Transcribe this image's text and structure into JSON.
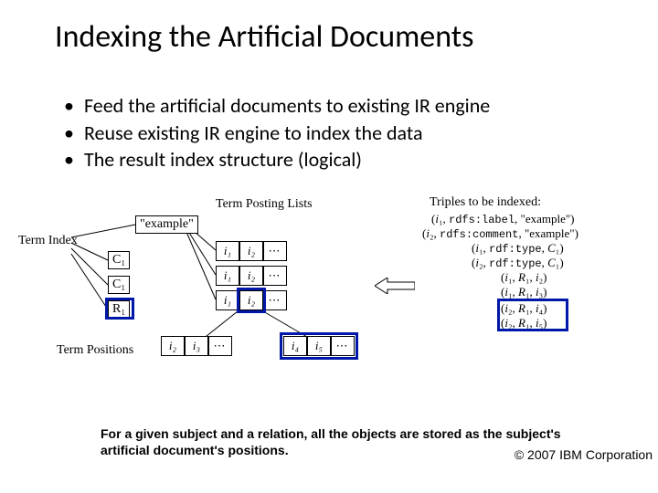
{
  "title": "Indexing the Artificial Documents",
  "bullets": [
    "Feed the artificial documents to existing IR engine",
    "Reuse existing IR engine to index the data",
    "The result index structure (logical)"
  ],
  "diagram": {
    "labels": {
      "term_posting_lists": "Term Posting Lists",
      "term_index": "Term Index",
      "term_positions": "Term Positions",
      "triples_header": "Triples to be indexed:"
    },
    "term_index_items": [
      "\"example\"",
      "C₁",
      "R₁"
    ],
    "posting_rows": [
      [
        "i₁",
        "i₂",
        "⋯"
      ],
      [
        "i₁",
        "i₂",
        "⋯"
      ],
      [
        "i₁",
        "i₂",
        "⋯"
      ]
    ],
    "position_rows": [
      [
        "i₂",
        "i₃",
        "⋯"
      ],
      [
        "i₄",
        "i₅",
        "⋯"
      ]
    ],
    "triples": [
      "(i₁, rdfs:label, \"example\")",
      "(i₂, rdfs:comment, \"example\")",
      "(i₁, rdf:type, C₁)",
      "(i₂, rdf:type, C₁)",
      "(i₁, R₁, i₂)",
      "(i₁, R₁, i₃)",
      "(i₂, R₁, i₄)",
      "(i₂, R₁, i₅)"
    ]
  },
  "caption": "For a given subject and a relation, all the objects are stored as the subject's artificial document's positions.",
  "copyright": "© 2007 IBM Corporation"
}
